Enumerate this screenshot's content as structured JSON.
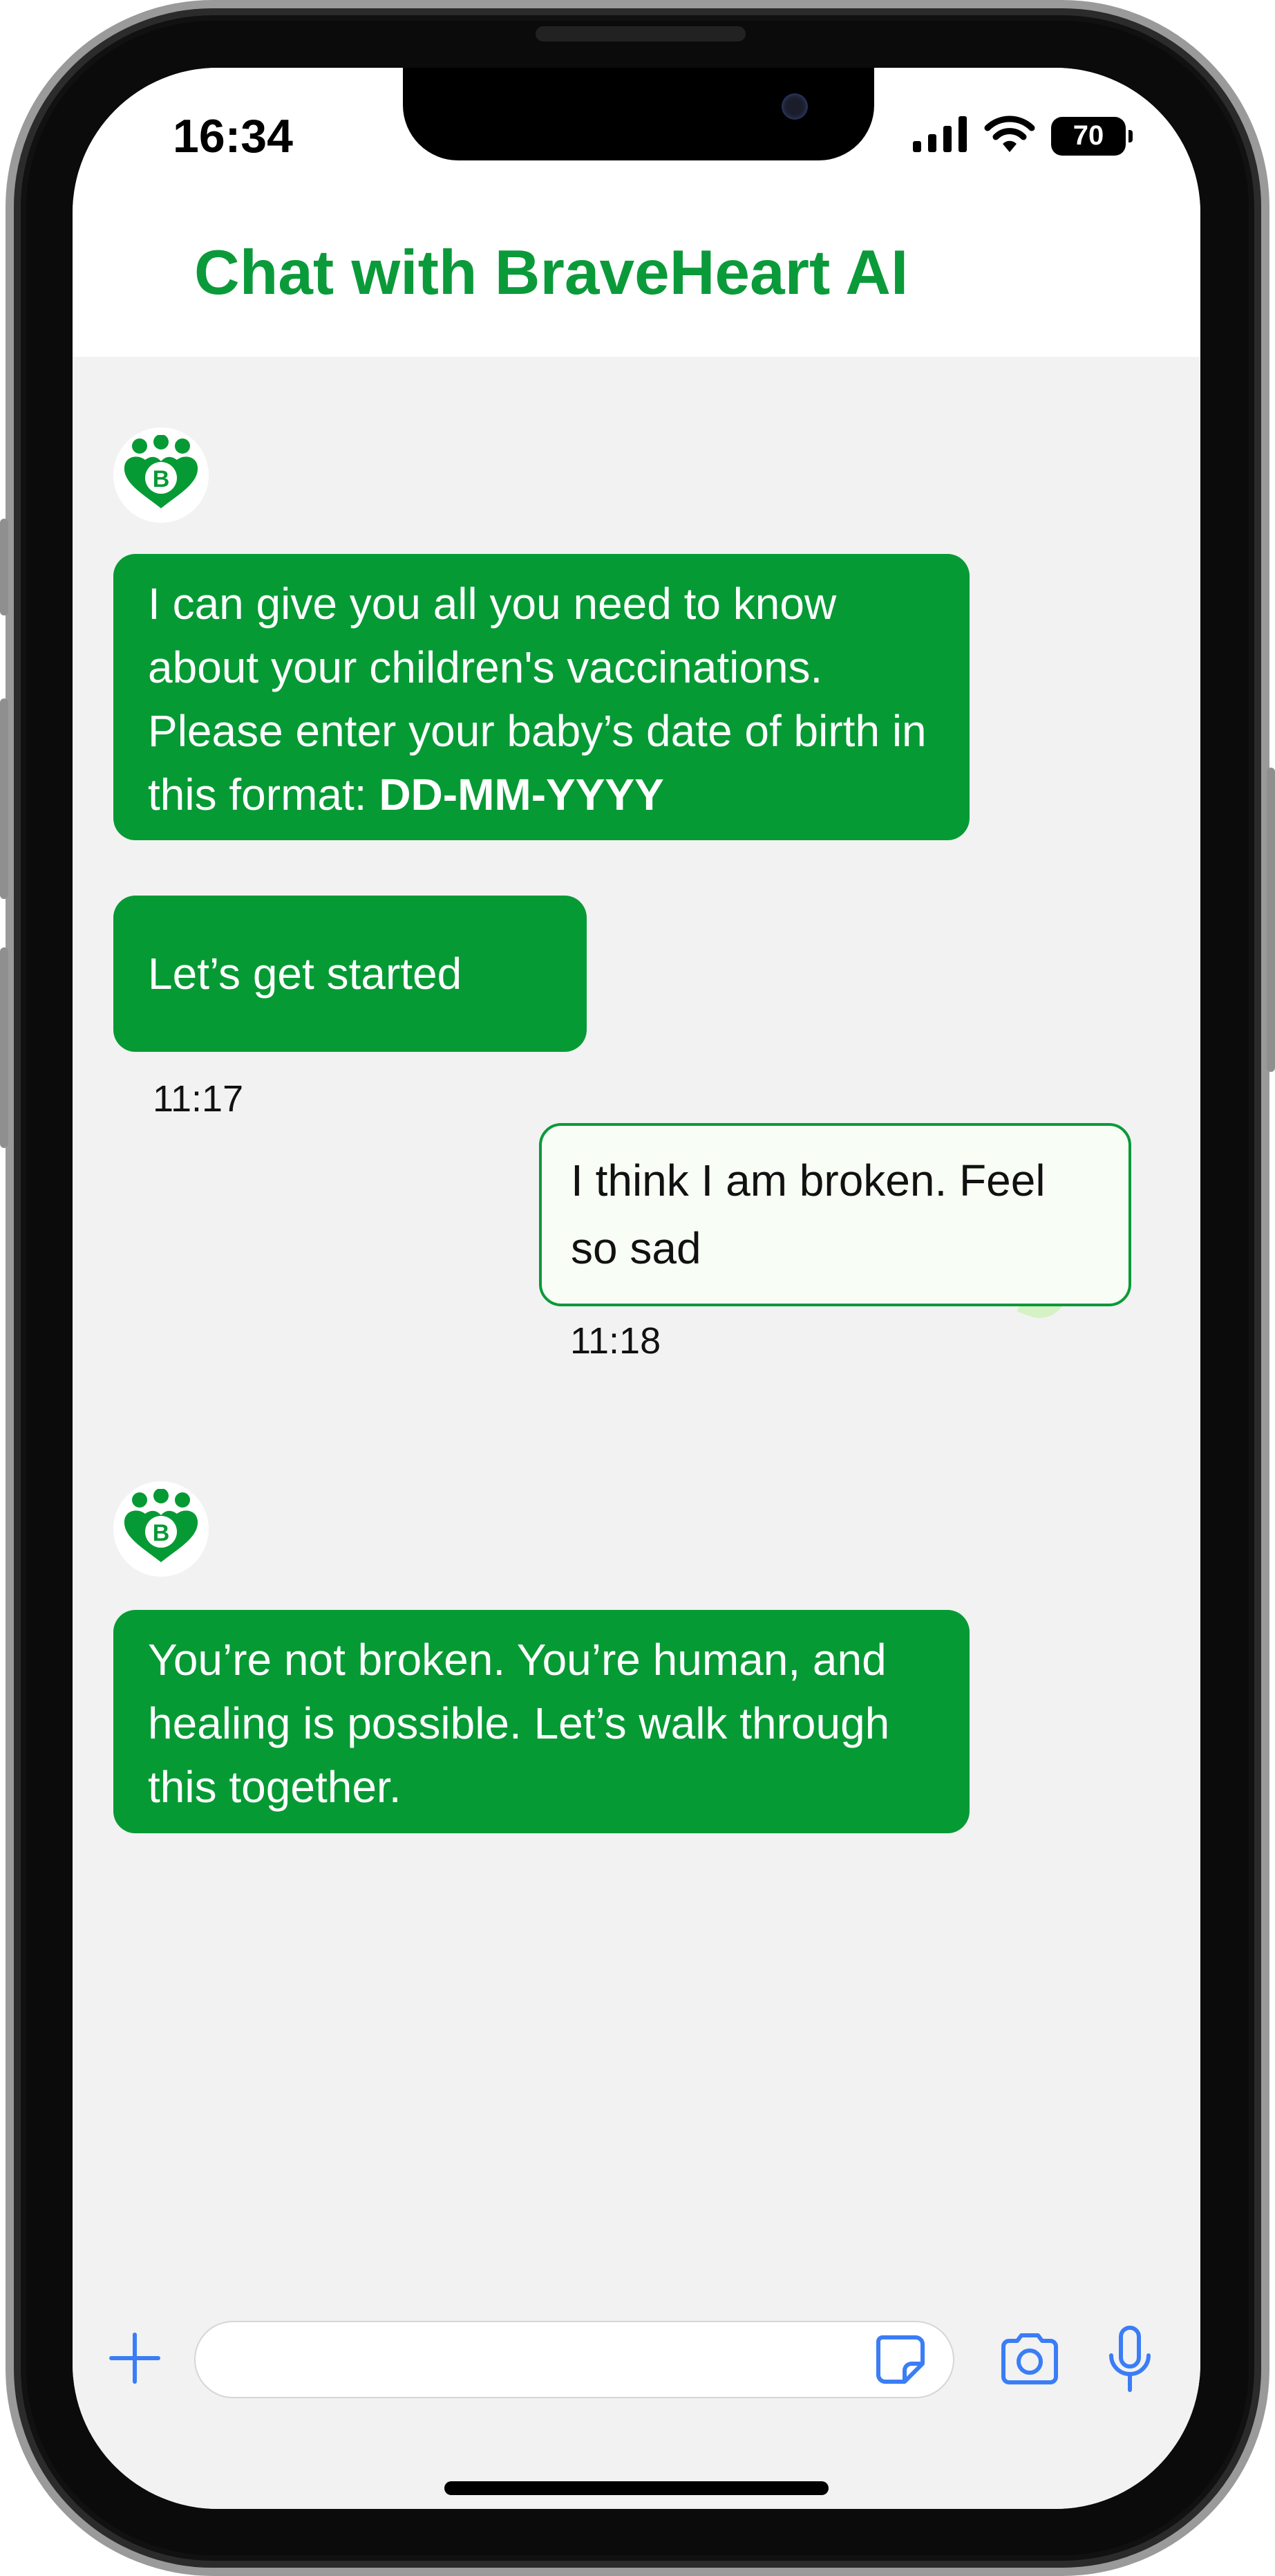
{
  "status_bar": {
    "time": "16:34",
    "battery_level": "70"
  },
  "header": {
    "title": "Chat with BraveHeart AI"
  },
  "assistant_avatar_letter": "B",
  "messages": [
    {
      "sender": "bot",
      "text": "I can give you all you need to know about your children's vaccinations. Please enter your baby’s date of birth in this format: ",
      "bold": "DD-MM-YYYY"
    },
    {
      "sender": "bot",
      "text": "Let’s get started",
      "time": "11:17"
    },
    {
      "sender": "user",
      "text": "I think I am broken. Feel so sad",
      "time": "11:18"
    },
    {
      "sender": "bot",
      "text": "You’re not broken. You’re human, and healing is possible. Let’s walk through this together."
    }
  ],
  "composer": {
    "input_value": "",
    "placeholder": ""
  },
  "colors": {
    "brand_green": "#069a34",
    "ios_blue": "#3a7df6",
    "user_bubble_bg": "#f8fdf5"
  },
  "icons": [
    "signal-icon",
    "wifi-icon",
    "battery-icon",
    "plus-icon",
    "sticker-icon",
    "camera-icon",
    "microphone-icon",
    "braveheart-logo-icon"
  ]
}
